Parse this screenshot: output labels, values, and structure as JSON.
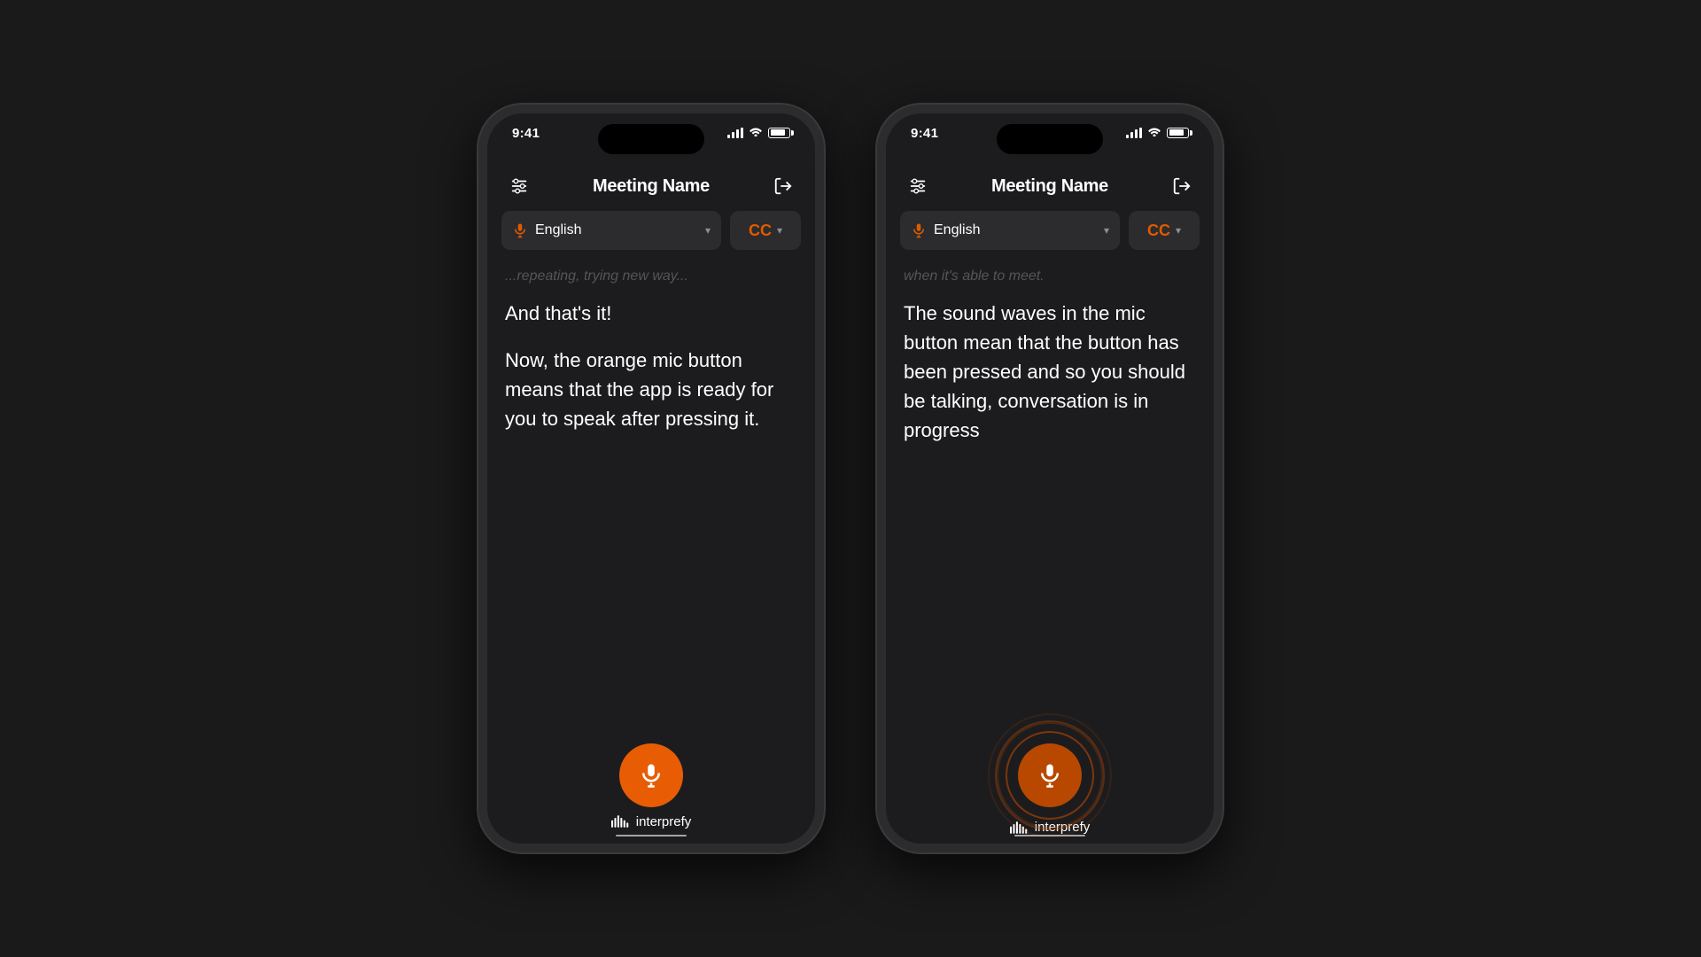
{
  "colors": {
    "background": "#1a1a1a",
    "phoneBg": "#1c1c1e",
    "phoneBorder": "#2c2c2e",
    "orange": "#e85d04",
    "orangeActive": "#b84800",
    "white": "#ffffff",
    "dimText": "#555555",
    "gray": "#8e8e93"
  },
  "phone1": {
    "statusBar": {
      "time": "9:41"
    },
    "header": {
      "title": "Meeting Name",
      "settingsIconLabel": "settings-icon",
      "exitIconLabel": "exit-icon"
    },
    "languageSelector": {
      "language": "English",
      "micIconLabel": "mic-language-icon"
    },
    "cc": {
      "label": "CC"
    },
    "content": {
      "fadedText": "...repeating, trying new way...",
      "paragraph1": "And that's it!",
      "paragraph2": "Now, the orange mic button means that the app is ready for you to speak after pressing it."
    },
    "micButton": {
      "state": "inactive",
      "label": "mic-button"
    },
    "brand": {
      "name": "interprefy",
      "iconLabel": "interprefy-logo-icon"
    }
  },
  "phone2": {
    "statusBar": {
      "time": "9:41"
    },
    "header": {
      "title": "Meeting Name",
      "settingsIconLabel": "settings-icon",
      "exitIconLabel": "exit-icon"
    },
    "languageSelector": {
      "language": "English",
      "micIconLabel": "mic-language-icon"
    },
    "cc": {
      "label": "CC"
    },
    "content": {
      "fadedText": "when it's able to meet.",
      "paragraph1": "The sound waves in the mic button mean  that the button has been pressed and so you should be talking, conversation is in progress"
    },
    "micButton": {
      "state": "active",
      "label": "mic-button-active"
    },
    "brand": {
      "name": "interprefy",
      "iconLabel": "interprefy-logo-icon"
    }
  }
}
